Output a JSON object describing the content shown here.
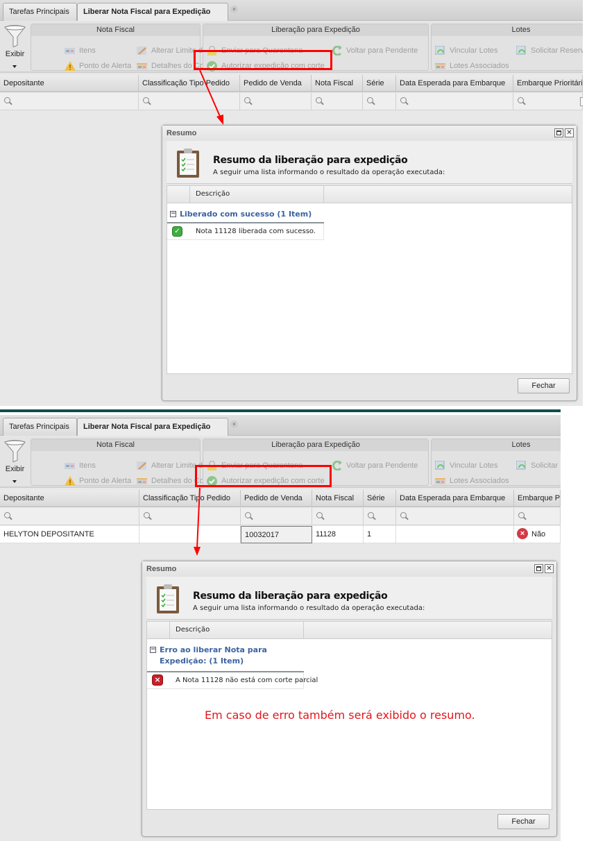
{
  "colors": {
    "accent_link": "#3b63a0",
    "annotation": "#e3161b",
    "highlight": "#ff0000",
    "teal_bar": "#0d4f4f"
  },
  "panels": [
    {
      "tabs": [
        {
          "label": "Tarefas Principais"
        },
        {
          "label": "Liberar Nota Fiscal para Expedição",
          "active": true,
          "closable": true
        }
      ],
      "toolbar": {
        "exibir_label": "Exibir",
        "groups": [
          {
            "title": "Nota Fiscal",
            "items": [
              {
                "label": "Itens",
                "icon": "list-icon"
              },
              {
                "label": "Alterar Limite de Corte",
                "icon": "edit-limit-icon"
              },
              {
                "label": "Ponto de Alerta",
                "icon": "warning-icon"
              },
              {
                "label": "Detalhes do Corte",
                "icon": "details-icon"
              }
            ]
          },
          {
            "title": "Liberação para Expedição",
            "items": [
              {
                "label": "Enviar para Quarentena",
                "icon": "lock-icon"
              },
              {
                "label": "Voltar para Pendente",
                "icon": "undo-arrow-icon"
              },
              {
                "label": "Autorizar expedição com corte",
                "icon": "check-circle-icon"
              }
            ]
          },
          {
            "title": "Lotes",
            "items": [
              {
                "label": "Vincular Lotes",
                "icon": "link-lots-icon"
              },
              {
                "label": "Solicitar Reserv",
                "icon": "request-reserve-icon"
              },
              {
                "label": "Lotes Associados",
                "icon": "details-icon"
              }
            ]
          }
        ]
      },
      "columns": [
        "Depositante",
        "Classificação Tipo Pedido",
        "Pedido de Venda",
        "Nota Fiscal",
        "Série",
        "Data Esperada para Embarque",
        "Embarque Prioritário"
      ],
      "rows": [],
      "dialog": {
        "title": "Resumo",
        "heading": "Resumo da liberação para expedição",
        "subheading": "A seguir uma lista informando o resultado da operação executada:",
        "column": "Descrição",
        "group": "Liberado com sucesso (1 Item)",
        "status": "success",
        "items": [
          "Nota 11128 liberada com sucesso."
        ],
        "close_label": "Fechar"
      }
    },
    {
      "tabs": [
        {
          "label": "Tarefas Principais"
        },
        {
          "label": "Liberar Nota Fiscal para Expedição",
          "active": true,
          "closable": true
        }
      ],
      "toolbar": {
        "exibir_label": "Exibir",
        "groups": [
          {
            "title": "Nota Fiscal",
            "items": [
              {
                "label": "Itens",
                "icon": "list-icon"
              },
              {
                "label": "Alterar Limite de Corte",
                "icon": "edit-limit-icon"
              },
              {
                "label": "Ponto de Alerta",
                "icon": "warning-icon"
              },
              {
                "label": "Detalhes do Corte",
                "icon": "details-icon"
              }
            ]
          },
          {
            "title": "Liberação para Expedição",
            "items": [
              {
                "label": "Enviar para Quarentena",
                "icon": "lock-icon"
              },
              {
                "label": "Voltar para Pendente",
                "icon": "undo-arrow-icon"
              },
              {
                "label": "Autorizar expedição com corte",
                "icon": "check-circle-icon"
              }
            ]
          },
          {
            "title": "Lotes",
            "items": [
              {
                "label": "Vincular Lotes",
                "icon": "link-lots-icon"
              },
              {
                "label": "Solicitar I",
                "icon": "request-reserve-icon"
              },
              {
                "label": "Lotes Associados",
                "icon": "details-icon"
              }
            ]
          }
        ]
      },
      "columns": [
        "Depositante",
        "Classificação Tipo Pedido",
        "Pedido de Venda",
        "Nota Fiscal",
        "Série",
        "Data Esperada para Embarque",
        "Embarque Pri"
      ],
      "rows": [
        [
          "HELYTON DEPOSITANTE",
          "",
          "10032017",
          "11128",
          "1",
          "",
          "Não"
        ]
      ],
      "dialog": {
        "title": "Resumo",
        "heading": "Resumo da liberação para expedição",
        "subheading": "A seguir uma lista informando o resultado da operação executada:",
        "column": "Descrição",
        "group": "Erro ao liberar Nota para Expedição: (1 Item)",
        "status": "error",
        "items": [
          "A Nota 11128 não está com corte parcial"
        ],
        "close_label": "Fechar",
        "annotation": "Em caso de erro também será exibido o resumo."
      }
    }
  ]
}
